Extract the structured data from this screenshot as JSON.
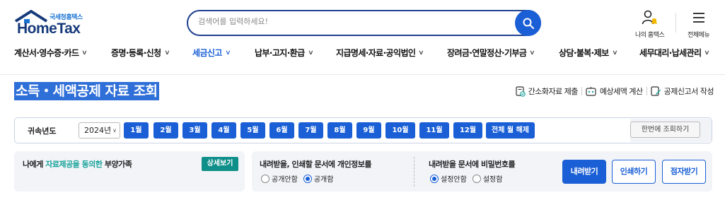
{
  "header": {
    "logo_kr": "국세청홈택스",
    "logo_en": "HomeTax",
    "search_placeholder": "검색어를 입력하세요!",
    "my_hometax": "나의 홈택스",
    "all_menu": "전체메뉴"
  },
  "nav": {
    "items": [
      {
        "label": "계산서·영수증·카드"
      },
      {
        "label": "증명·등록·신청"
      },
      {
        "label": "세금신고"
      },
      {
        "label": "납부·고지·환급"
      },
      {
        "label": "지급명세·자료·공익법인"
      },
      {
        "label": "장려금·연말정산·기부금"
      },
      {
        "label": "상담·불복·제보"
      },
      {
        "label": "세무대리·납세관리"
      }
    ],
    "active_index": 2
  },
  "page": {
    "title": "소득・세액공제 자료 조회",
    "actions": [
      "간소화자료 제출",
      "예상세액 계산",
      "공제신고서 작성"
    ]
  },
  "year_panel": {
    "label": "귀속년도",
    "selected_year": "2024년",
    "months": [
      "1월",
      "2월",
      "3월",
      "4월",
      "5월",
      "6월",
      "7월",
      "8월",
      "9월",
      "10월",
      "11월",
      "12월"
    ],
    "clear_all": "전체 월 해제",
    "query_once": "한번에 조회하기"
  },
  "consent_panel": {
    "text_before": "나에게 ",
    "text_highlight": "자료제공을 동의한",
    "text_after": " 부양가족",
    "detail_button": "상세보기"
  },
  "privacy_panel": {
    "question": "내려받을, 인쇄할 문서에 개인정보를",
    "options": [
      "공개안함",
      "공개함"
    ],
    "selected": 1
  },
  "password_panel": {
    "question": "내려받을 문서에 비밀번호를",
    "options": [
      "설정안함",
      "설정함"
    ],
    "selected": 0
  },
  "buttons": {
    "download": "내려받기",
    "print": "인쇄하기",
    "braille": "점자받기"
  },
  "colors": {
    "primary": "#1a5fd6",
    "navy": "#163a7a",
    "teal": "#0f8f8a",
    "highlight_text": "#1aa39a"
  }
}
